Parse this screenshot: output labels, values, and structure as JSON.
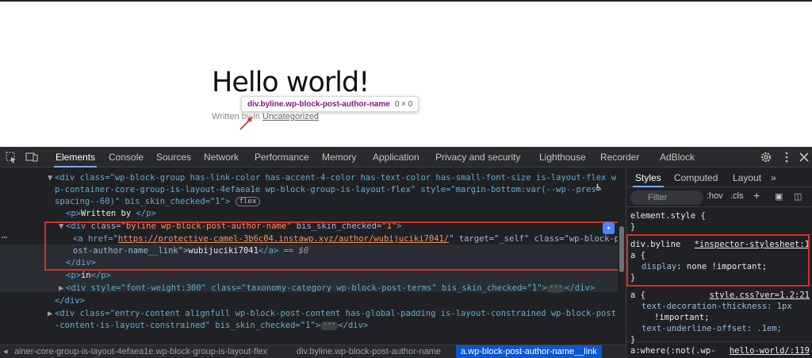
{
  "page": {
    "title": "Hello world!",
    "byline_prefix": "Written by",
    "byline_in": "in",
    "category_link": "Uncategorized",
    "tooltip_selector": "div.byline.wp-block-post-author-name",
    "tooltip_dims": "0 × 0"
  },
  "devtools": {
    "tabs": [
      "Elements",
      "Console",
      "Sources",
      "Network",
      "Performance",
      "Memory",
      "Application",
      "Privacy and security",
      "Lighthouse",
      "Recorder",
      "AdBlock"
    ],
    "dom": {
      "l1": "<div class=\"wp-block-group has-link-color has-accent-4-color has-text-color has-small-font-size is-layout-flex w",
      "l2": "p-container-core-group-is-layout-4efaea1e wp-block-group-is-layout-flex\" style=\"margin-bottom:var(--wp--pres",
      "l3": "spacing--60)\" bis_skin_checked=\"1\">",
      "flex_badge": "flex",
      "l4_tag": "<p>",
      "l4_text": "Written by ",
      "l4_close": "</p>",
      "l5_open": "<div ",
      "l5_cls_name": "class=",
      "l5_cls_val": "\"byline wp-block-post-author-name\"",
      "l5_bis": " bis_skin_checked=",
      "l5_bis_val": "\"1\"",
      "l6_pre": "<a href=\"",
      "l6_url": "https://protective-camel-3b6c04.instawp.xyz/author/wubijuciki7041/",
      "l6_post": "\" target=\"_self\" class=\"wp-block-p",
      "l7_a": "ost-author-name__link\">",
      "l7_text": "wubijuciki7041",
      "l7_close": "</a>",
      "l7_eq": " == $0",
      "l8": "</div>",
      "l9_tag": "<p>",
      "l9_text": "in",
      "l9_close": "</p>",
      "l10": "<div style=\"font-weight:300\" class=\"taxonomy-category wp-block-post-terms\" bis_skin_checked=\"1\">",
      "l10_end": "</div>",
      "l11": "</div>",
      "l12": "<div class=\"entry-content alignfull wp-block-post-content has-global-padding is-layout-constrained wp-block-post",
      "l13": "-content-is-layout-constrained\" bis_skin_checked=\"1\">",
      "l13_end": "</div>",
      "ellipsis": "···"
    },
    "breadcrumbs": [
      "ainer-core-group-is-layout-4efaea1e.wp-block-group-is-layout-flex",
      "div.byline.wp-block-post-author-name",
      "a.wp-block-post-author-name__link"
    ],
    "styles": {
      "tabs": [
        "Styles",
        "Computed",
        "Layout"
      ],
      "filter_placeholder": "Filter",
      "hov": ":hov",
      "cls": ".cls",
      "rules": [
        {
          "selector": "element.style {",
          "close": "}"
        },
        {
          "selector": "div.byline",
          "selector2": "a {",
          "source": "*inspector-stylesheet:1",
          "prop": "display",
          "value": "none !important;",
          "close": "}"
        },
        {
          "selector": "a {",
          "source": "style.css?ver=1.2:21",
          "props": [
            "text-decoration-thickness: 1px",
            "!important;",
            "text-underline-offset: .1em;"
          ],
          "close": "}"
        },
        {
          "selector": "a:where(:not(.wp-",
          "source": "hello-world/:119"
        }
      ]
    }
  }
}
